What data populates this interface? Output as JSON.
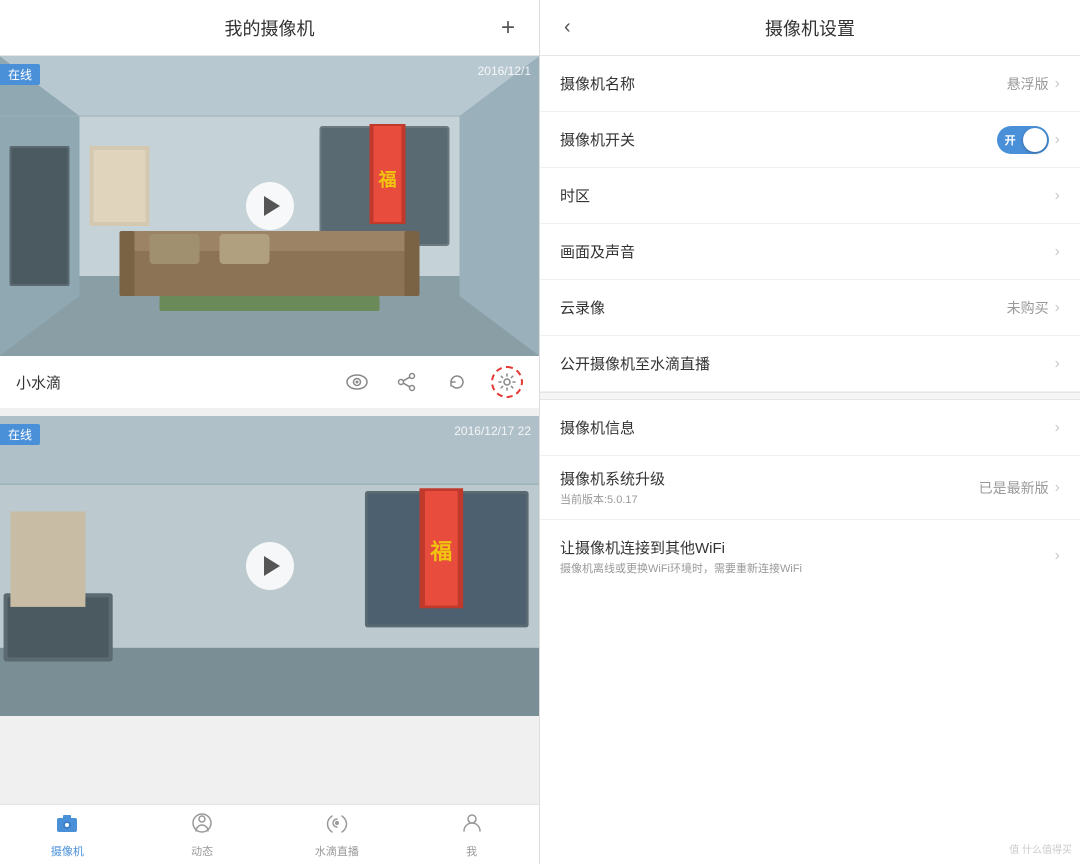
{
  "left": {
    "header": {
      "title": "我的摄像机",
      "add_button": "+"
    },
    "cameras": [
      {
        "id": "camera-1",
        "status": "在线",
        "timestamp": "2016/12/1",
        "name": "小水滴"
      },
      {
        "id": "camera-2",
        "status": "在线",
        "timestamp": "2016/12/17  22",
        "name": ""
      }
    ],
    "bottom_nav": [
      {
        "id": "camera",
        "label": "摄像机",
        "active": true
      },
      {
        "id": "activity",
        "label": "动态",
        "active": false
      },
      {
        "id": "live",
        "label": "水滴直播",
        "active": false
      },
      {
        "id": "me",
        "label": "我",
        "active": false
      }
    ]
  },
  "right": {
    "header": {
      "title": "摄像机设置",
      "back_label": "‹"
    },
    "settings": [
      {
        "id": "name",
        "label": "摄像机名称",
        "value": "悬浮版",
        "type": "nav"
      },
      {
        "id": "switch",
        "label": "摄像机开关",
        "value": "开",
        "type": "toggle"
      },
      {
        "id": "timezone",
        "label": "时区",
        "value": "",
        "type": "nav"
      },
      {
        "id": "av",
        "label": "画面及声音",
        "value": "",
        "type": "nav"
      },
      {
        "id": "cloud",
        "label": "云录像",
        "value": "未购买",
        "type": "nav"
      },
      {
        "id": "live",
        "label": "公开摄像机至水滴直播",
        "value": "",
        "type": "nav"
      },
      {
        "id": "divider",
        "type": "divider"
      },
      {
        "id": "info",
        "label": "摄像机信息",
        "value": "",
        "type": "nav"
      },
      {
        "id": "upgrade",
        "label": "摄像机系统升级",
        "sublabel": "当前版本:5.0.17",
        "value": "已是最新版",
        "type": "nav"
      },
      {
        "id": "wifi",
        "label": "让摄像机连接到其他WiFi",
        "sublabel": "摄像机离线或更换WiFi环境时，需要重新连接WiFi",
        "value": "",
        "type": "nav"
      }
    ],
    "watermark": "值  什么值得买"
  }
}
